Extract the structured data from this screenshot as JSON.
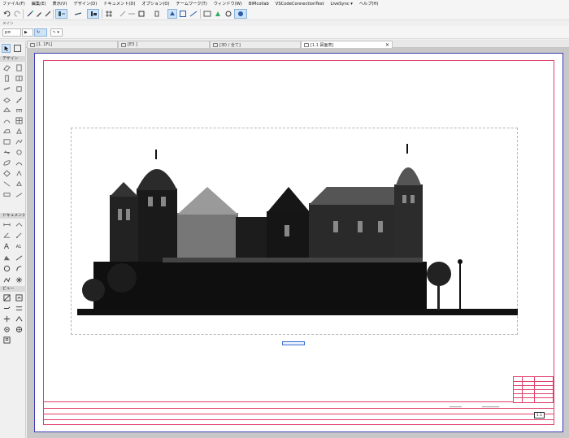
{
  "menu": [
    "ファイル(F)",
    "編集(E)",
    "表示(V)",
    "デザイン(D)",
    "ドキュメント(D)",
    "オプション(O)",
    "チームワーク(T)",
    "ウィンドウ(W)",
    "BIMcollab",
    "VSCodeConnectionTest",
    "LiveSync ▾",
    "ヘルプ(H)"
  ],
  "toolbar_label": "メイン",
  "toolbar2": {
    "pen_value": "p≡",
    "arrow_label": "▾"
  },
  "tabs": [
    {
      "label": "[1. 1FL]",
      "active": false
    },
    {
      "label": "[E3 ]",
      "active": false
    },
    {
      "label": "[3D / 全て]",
      "active": false
    },
    {
      "label": "[1.1 図面表]",
      "active": true
    }
  ],
  "tab_close": "✕",
  "toolbox": {
    "section_design": "デザイン",
    "section_document": "ドキュメント",
    "section_view": "ビュー",
    "text_tool": "A",
    "label_tool": "A1"
  },
  "sheet": {
    "sheet_number": "1.1",
    "title_text_1": "━━━━━━━",
    "title_text_2": "━━━━━━━━━━"
  },
  "colors": {
    "sheet_border": "#e0406a",
    "paper_edge": "#3b3bb5",
    "selection": "#cfe3f7",
    "canvas_bg": "#c8c8c8"
  }
}
